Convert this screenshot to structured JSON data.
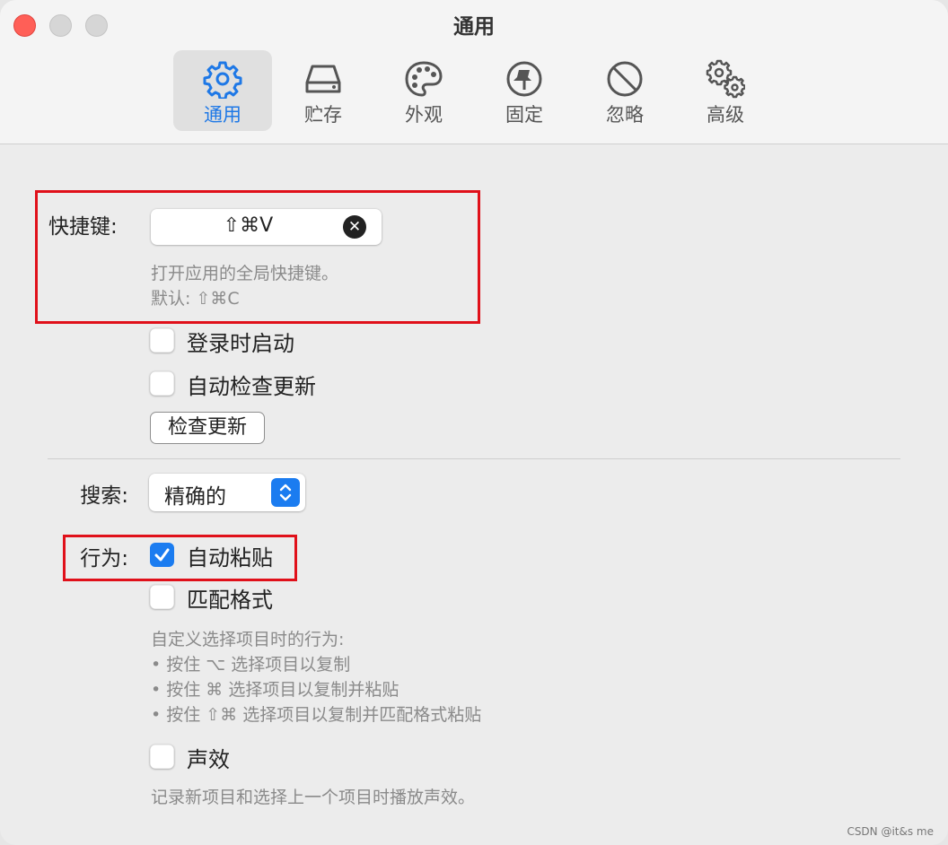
{
  "window": {
    "title": "通用"
  },
  "tabs": [
    {
      "label": "通用",
      "icon": "gear-icon",
      "active": true
    },
    {
      "label": "贮存",
      "icon": "storage-drive-icon",
      "active": false
    },
    {
      "label": "外观",
      "icon": "palette-icon",
      "active": false
    },
    {
      "label": "固定",
      "icon": "pin-icon",
      "active": false
    },
    {
      "label": "忽略",
      "icon": "prohibited-icon",
      "active": false
    },
    {
      "label": "高级",
      "icon": "gears-icon",
      "active": false
    }
  ],
  "shortcut": {
    "label": "快捷键:",
    "value": "⇧⌘V",
    "clear_glyph": "✕",
    "hint_line1": "打开应用的全局快捷键。",
    "hint_line2": "默认: ⇧⌘C"
  },
  "startup": {
    "launch_at_login": {
      "label": "登录时启动",
      "checked": false
    },
    "auto_check_updates": {
      "label": "自动检查更新",
      "checked": false
    },
    "check_updates_button": "检查更新"
  },
  "search": {
    "label": "搜索:",
    "value": "精确的"
  },
  "behavior": {
    "label": "行为:",
    "auto_paste": {
      "label": "自动粘贴",
      "checked": true
    },
    "match_format": {
      "label": "匹配格式",
      "checked": false
    },
    "hint_title": "自定义选择项目时的行为:",
    "hint_items": [
      "• 按住 ⌥ 选择项目以复制",
      "• 按住 ⌘ 选择项目以复制并粘贴",
      "• 按住 ⇧⌘ 选择项目以复制并匹配格式粘贴"
    ]
  },
  "sound": {
    "label": "声效",
    "checked": false,
    "hint": "记录新项目和选择上一个项目时播放声效。"
  },
  "watermark": "CSDN @it&s me",
  "colors": {
    "accent": "#1b7cf0",
    "highlight_box": "#e0101a",
    "close": "#ff5f57"
  }
}
